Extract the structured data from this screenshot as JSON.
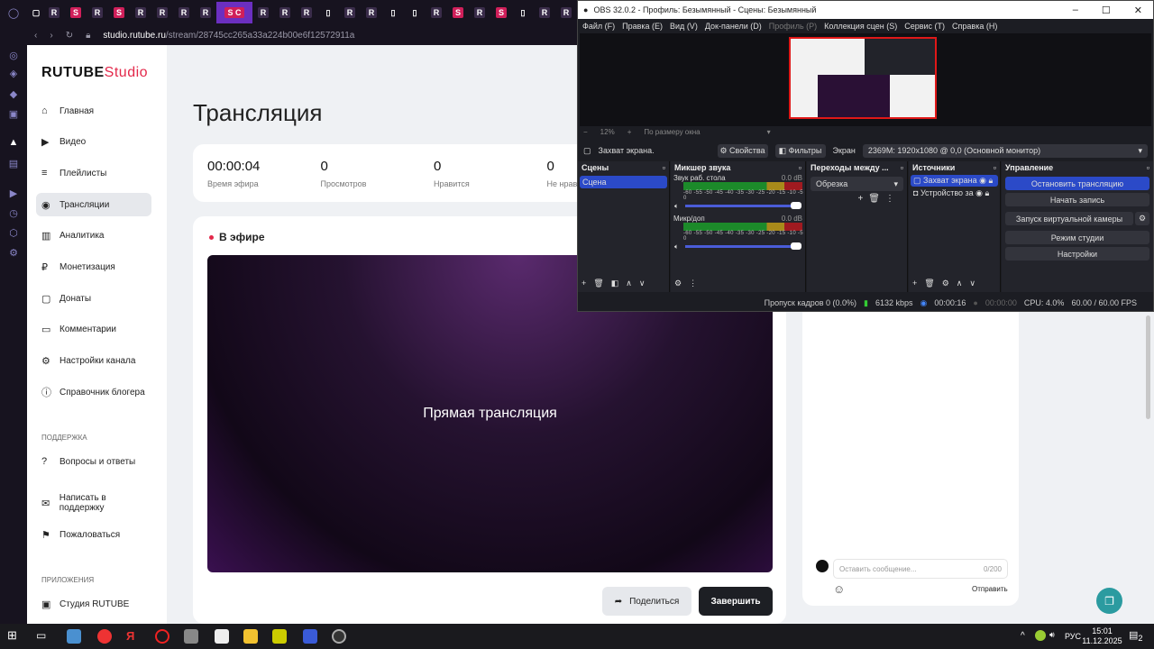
{
  "browser": {
    "tabs": [
      "R",
      "S",
      "R",
      "S",
      "R",
      "R",
      "R",
      "R",
      "S C",
      "R",
      "R",
      "R",
      "doc",
      "R",
      "R",
      "doc",
      "doc",
      "R",
      "S",
      "R",
      "S",
      "doc",
      "R",
      "R"
    ],
    "url_host": "studio.rutube.ru",
    "url_path": "/stream/28745cc265a33a224b00e6f12572911a"
  },
  "sidebar": {
    "logo_main": "RUTUBE",
    "logo_sub": "Studio",
    "items": [
      {
        "label": "Главная"
      },
      {
        "label": "Видео"
      },
      {
        "label": "Плейлисты"
      },
      {
        "label": "Трансляции"
      },
      {
        "label": "Аналитика"
      },
      {
        "label": "Монетизация"
      },
      {
        "label": "Донаты"
      },
      {
        "label": "Комментарии"
      },
      {
        "label": "Настройки канала"
      },
      {
        "label": "Справочник блогера"
      }
    ],
    "support_header": "ПОДДЕРЖКА",
    "support_items": [
      {
        "label": "Вопросы и ответы"
      },
      {
        "label": "Написать в поддержку"
      },
      {
        "label": "Пожаловаться"
      }
    ],
    "apps_header": "ПРИЛОЖЕНИЯ",
    "apps_items": [
      {
        "label": "Студия RUTUBE"
      }
    ]
  },
  "main": {
    "title": "Трансляция",
    "stats": [
      {
        "value": "00:00:04",
        "label": "Время эфира"
      },
      {
        "value": "0",
        "label": "Просмотров"
      },
      {
        "value": "0",
        "label": "Нравится"
      },
      {
        "value": "0",
        "label": "Не нрав"
      }
    ],
    "live_label": "В эфире",
    "player_text": "Прямая трансляция",
    "share_label": "Поделиться",
    "finish_label": "Завершить"
  },
  "chat": {
    "placeholder": "Оставить сообщение...",
    "counter": "0/200",
    "send_label": "Отправить"
  },
  "obs": {
    "title": "OBS 32.0.2 - Профиль: Безымянный - Сцены: Безымянный",
    "menu": [
      "Файл (F)",
      "Правка (E)",
      "Вид (V)",
      "Док-панели (D)",
      "Профиль (P)",
      "Коллекция сцен (S)",
      "Сервис (T)",
      "Справка (H)"
    ],
    "zoom": "12%",
    "fit": "По размеру окна",
    "source_name": "Захват экрана.",
    "properties": "Свойства",
    "filters": "Фильтры",
    "screen_label": "Экран",
    "screen_value": "2369M: 1920x1080 @ 0,0 (Основной монитор)",
    "scenes_header": "Сцены",
    "scene": "Сцена",
    "mixer_header": "Микшер звука",
    "channels": [
      {
        "name": "Звук раб. стола",
        "db": "0.0 dB"
      },
      {
        "name": "Микр/доп",
        "db": "0.0 dB"
      }
    ],
    "scale": "-60 -55 -50 -45 -40 -35 -30 -25 -20 -15 -10 -5 0",
    "transitions_header": "Переходы между ...",
    "transition": "Обрезка",
    "sources_header": "Источники",
    "sources": [
      "Захват экрана",
      "Устройство за"
    ],
    "controls_header": "Управление",
    "controls": {
      "stop": "Остановить трансляцию",
      "record": "Начать запись",
      "virtualcam": "Запуск виртуальной камеры",
      "studio": "Режим студии",
      "settings": "Настройки"
    },
    "status": {
      "dropped": "Пропуск кадров 0 (0.0%)",
      "bitrate": "6132 kbps",
      "stream_time": "00:00:16",
      "rec_time": "00:00:00",
      "cpu": "CPU: 4.0%",
      "fps": "60.00 / 60.00 FPS"
    }
  },
  "taskbar": {
    "lang": "РУС",
    "time": "15:01",
    "date": "11.12.2025",
    "notifications": "2"
  }
}
